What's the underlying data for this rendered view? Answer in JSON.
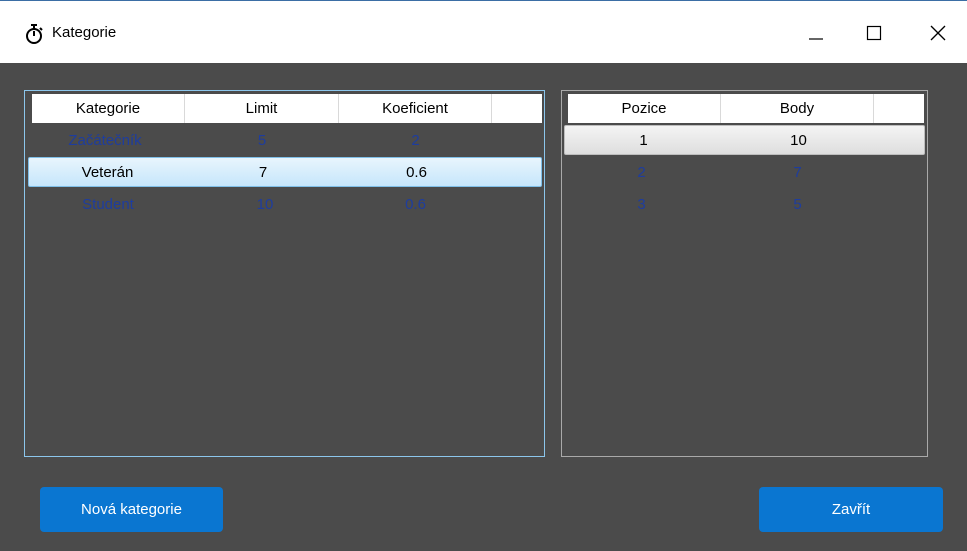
{
  "window": {
    "title": "Kategorie",
    "icon": "stopwatch-icon",
    "controls": [
      "minimize-icon",
      "maximize-icon",
      "close-icon"
    ]
  },
  "categories_grid": {
    "columns": [
      "Kategorie",
      "Limit",
      "Koeficient"
    ],
    "rows": [
      {
        "kategorie": "Začátečník",
        "limit": "5",
        "koeficient": "2",
        "selected": false
      },
      {
        "kategorie": "Veterán",
        "limit": "7",
        "koeficient": "0.6",
        "selected": true
      },
      {
        "kategorie": "Student",
        "limit": "10",
        "koeficient": "0.6",
        "selected": false
      }
    ]
  },
  "points_grid": {
    "columns": [
      "Pozice",
      "Body"
    ],
    "rows": [
      {
        "pozice": "1",
        "body": "10",
        "selected": true
      },
      {
        "pozice": "2",
        "body": "7",
        "selected": false
      },
      {
        "pozice": "3",
        "body": "5",
        "selected": false
      }
    ]
  },
  "buttons": {
    "new_category": "Nová kategorie",
    "close": "Zavřít"
  },
  "colors": {
    "background": "#4b4b4b",
    "accent_button": "#0a76d1",
    "row_text": "#1e3d9e",
    "selection_border": "#7fbfe8"
  }
}
